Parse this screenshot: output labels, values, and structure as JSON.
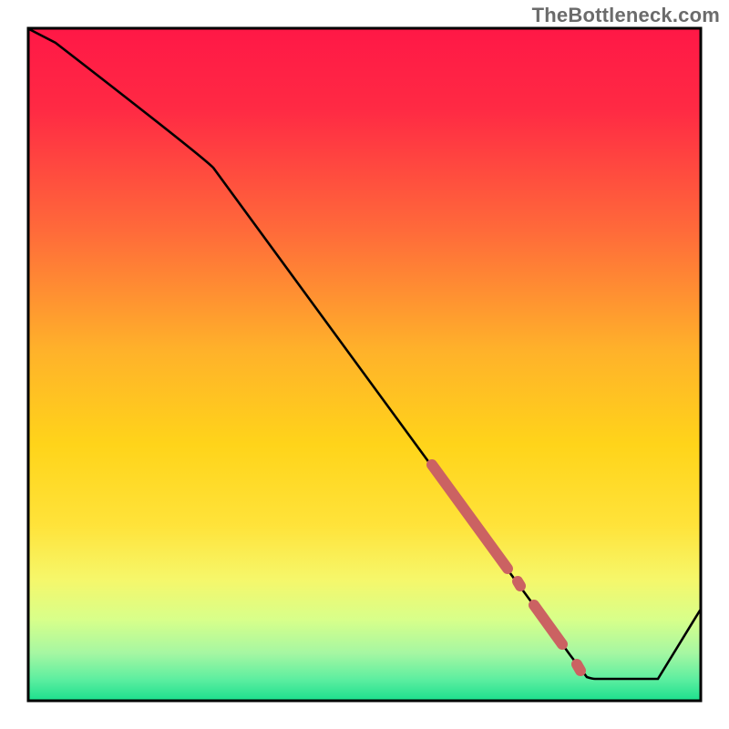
{
  "watermark": "TheBottleneck.com",
  "chart_data": {
    "type": "line",
    "title": "",
    "xlabel": "",
    "ylabel": "",
    "xlim": [
      0,
      100
    ],
    "ylim": [
      0,
      100
    ],
    "grid": false,
    "legend": false,
    "series": [
      {
        "name": "curve",
        "x": [
          0,
          4.0,
          27.5,
          70.6,
          74.4,
          78.1,
          80.6,
          83.1,
          84.4,
          93.8,
          100
        ],
        "values": [
          100,
          97.9,
          79.3,
          20.5,
          15.3,
          10.1,
          6.7,
          3.3,
          3.2,
          3.2,
          13.3
        ]
      }
    ],
    "markers": [
      {
        "name": "dash-segment-1",
        "x": [
          60.0,
          71.3
        ],
        "y": [
          35.1,
          19.6
        ]
      },
      {
        "name": "dash-dot-1",
        "x": [
          72.8,
          73.3
        ],
        "y": [
          17.6,
          16.9
        ]
      },
      {
        "name": "dash-segment-2",
        "x": [
          75.3,
          79.5
        ],
        "y": [
          14.1,
          8.2
        ]
      },
      {
        "name": "dash-dot-2",
        "x": [
          81.6,
          82.3
        ],
        "y": [
          5.3,
          4.4
        ]
      }
    ],
    "colors": {
      "curve": "#000000",
      "marker": "#cb6262",
      "gradient_top": "#ff1846",
      "gradient_mid": "#ffd400",
      "gradient_low": "#d8ff6a",
      "gradient_bottom": "#1ee08e",
      "frame": "#000000"
    }
  }
}
